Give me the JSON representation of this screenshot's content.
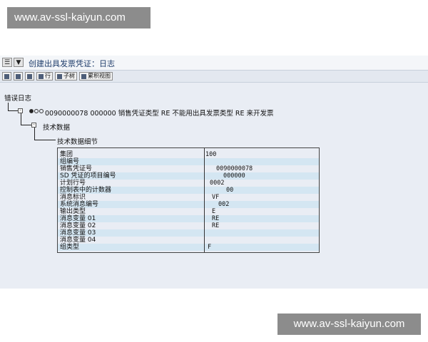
{
  "watermark": {
    "top": "www.av-ssl-kaiyun.com",
    "bottom": "www.av-ssl-kaiyun.com"
  },
  "window": {
    "title": "创建出具发票凭证：日志"
  },
  "toolbar": {
    "row_label": "行",
    "subtree_label": "子树",
    "cumulative_label": "累积视图"
  },
  "tree": {
    "root_label": "错误日志",
    "message_line": "0090000078 000000 销售凭证类型 RE 不能用出具发票类型 RE 来开发票",
    "tech_data_label": "技术数据",
    "tech_detail_label": "技术数据细节"
  },
  "details": {
    "rows": [
      {
        "label": "集团",
        "value": "100"
      },
      {
        "label": "组编号",
        "value": ""
      },
      {
        "label": "销售凭证号",
        "value": "0090000078"
      },
      {
        "label": "SD 凭证的项目编号",
        "value": "000000"
      },
      {
        "label": "计划行号",
        "value": "0002"
      },
      {
        "label": "控制表中的计数器",
        "value": "00"
      },
      {
        "label": "消息标识",
        "value": "VF"
      },
      {
        "label": "系统消息编号",
        "value": "002"
      },
      {
        "label": "输出类型",
        "value": "E"
      },
      {
        "label": "消息变量 01",
        "value": "RE"
      },
      {
        "label": "消息变量 02",
        "value": "RE"
      },
      {
        "label": "消息变量 03",
        "value": ""
      },
      {
        "label": "消息变量 04",
        "value": ""
      },
      {
        "label": "组类型",
        "value": "F"
      }
    ]
  }
}
